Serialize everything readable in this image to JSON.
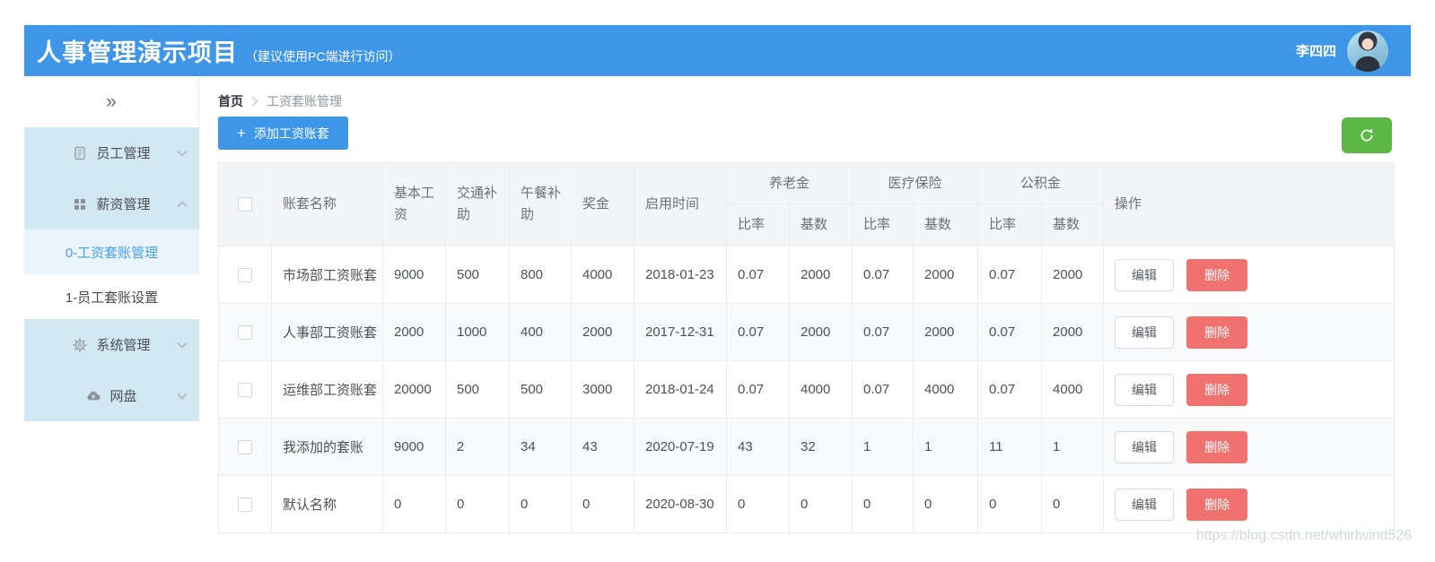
{
  "header": {
    "title": "人事管理演示项目",
    "subtitle": "（建议使用PC端进行访问）",
    "username": "李四四"
  },
  "sidebar": {
    "collapse_glyph": "»",
    "items": [
      {
        "label": "员工管理",
        "icon": "document-icon",
        "expanded": false
      },
      {
        "label": "薪资管理",
        "icon": "grid-icon",
        "expanded": true
      },
      {
        "label": "0-工资套账管理",
        "type": "submenu",
        "active": true
      },
      {
        "label": "1-员工套账设置",
        "type": "submenu",
        "active": false
      },
      {
        "label": "系统管理",
        "icon": "gear-icon",
        "expanded": false
      },
      {
        "label": "网盘",
        "icon": "cloud-icon",
        "expanded": false
      }
    ]
  },
  "breadcrumb": {
    "home": "首页",
    "current": "工资套账管理"
  },
  "toolbar": {
    "add_label": "添加工资账套",
    "add_icon": "+",
    "refresh_icon": "refresh-icon"
  },
  "table": {
    "columns": [
      "账套名称",
      "基本工资",
      "交通补助",
      "午餐补助",
      "奖金",
      "启用时间"
    ],
    "groups": [
      {
        "label": "养老金",
        "children": [
          "比率",
          "基数"
        ]
      },
      {
        "label": "医疗保险",
        "children": [
          "比率",
          "基数"
        ]
      },
      {
        "label": "公积金",
        "children": [
          "比率",
          "基数"
        ]
      }
    ],
    "actions_label": "操作",
    "edit_label": "编辑",
    "delete_label": "删除",
    "rows": [
      {
        "name": "市场部工资账套",
        "base_salary": "9000",
        "transport": "500",
        "lunch": "800",
        "bonus": "4000",
        "start_date": "2018-01-23",
        "pension_rate": "0.07",
        "pension_base": "2000",
        "medical_rate": "0.07",
        "medical_base": "2000",
        "fund_rate": "0.07",
        "fund_base": "2000"
      },
      {
        "name": "人事部工资账套",
        "base_salary": "2000",
        "transport": "1000",
        "lunch": "400",
        "bonus": "2000",
        "start_date": "2017-12-31",
        "pension_rate": "0.07",
        "pension_base": "2000",
        "medical_rate": "0.07",
        "medical_base": "2000",
        "fund_rate": "0.07",
        "fund_base": "2000"
      },
      {
        "name": "运维部工资账套",
        "base_salary": "20000",
        "transport": "500",
        "lunch": "500",
        "bonus": "3000",
        "start_date": "2018-01-24",
        "pension_rate": "0.07",
        "pension_base": "4000",
        "medical_rate": "0.07",
        "medical_base": "4000",
        "fund_rate": "0.07",
        "fund_base": "4000"
      },
      {
        "name": "我添加的套账",
        "base_salary": "9000",
        "transport": "2",
        "lunch": "34",
        "bonus": "43",
        "start_date": "2020-07-19",
        "pension_rate": "43",
        "pension_base": "32",
        "medical_rate": "1",
        "medical_base": "1",
        "fund_rate": "11",
        "fund_base": "1"
      },
      {
        "name": "默认名称",
        "base_salary": "0",
        "transport": "0",
        "lunch": "0",
        "bonus": "0",
        "start_date": "2020-08-30",
        "pension_rate": "0",
        "pension_base": "0",
        "medical_rate": "0",
        "medical_base": "0",
        "fund_rate": "0",
        "fund_base": "0"
      }
    ]
  },
  "page": {
    "watermark": "https://blog.csdn.net/whirlwind526"
  },
  "colors": {
    "header_bg": "#3e96e8",
    "primary_blue": "#3e96e8",
    "sidebar_bg": "#d2e8f3",
    "sidebar_active_bg": "#ebf3fc",
    "sidebar_active_text": "#4a9fe8",
    "refresh_green": "#5cb843",
    "delete_red": "#f0716e",
    "table_header_bg": "#f4f5f8"
  }
}
